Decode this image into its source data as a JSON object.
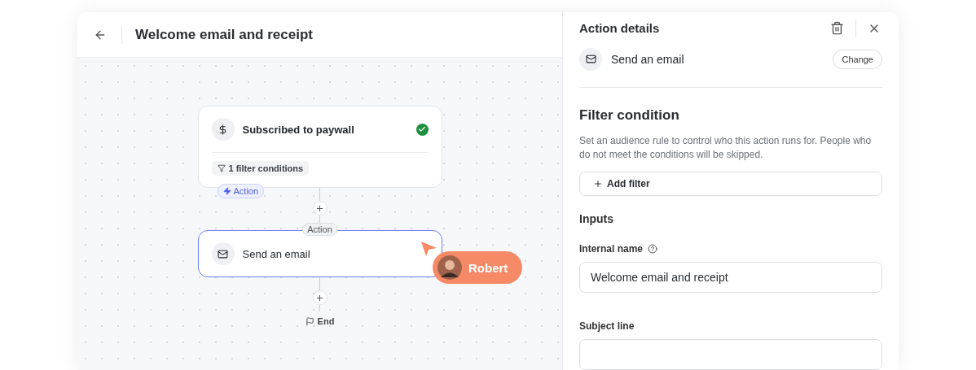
{
  "header": {
    "title": "Welcome email and receipt"
  },
  "flow": {
    "trigger": {
      "title": "Subscribed to paywall",
      "complete": true,
      "filter": "1 filter conditions",
      "badge": "Action"
    },
    "steps": [
      {
        "label": "Action",
        "title": "Send an email",
        "selected": true
      }
    ],
    "end": "End"
  },
  "cursor": {
    "name": "Robert"
  },
  "panel": {
    "title": "Action details",
    "action": {
      "title": "Send an email",
      "button": "Change"
    },
    "filter_section": {
      "heading": "Filter condition",
      "description": "Set an audience rule to control who this action runs for. People who do not meet the conditions will be skipped.",
      "add": "Add filter"
    },
    "inputs": {
      "heading": "Inputs",
      "fields": [
        {
          "label": "Internal name",
          "help": true,
          "value": "Welcome email and receipt"
        },
        {
          "label": "Subject line",
          "help": false
        }
      ]
    }
  }
}
